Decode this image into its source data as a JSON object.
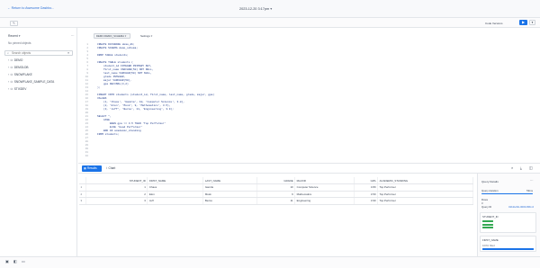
{
  "window": {
    "back_link": "Return to Awesome Dashbo...",
    "title": "2023-12-20 3:17pm"
  },
  "toolbar": {
    "code_version_label": "Code Versions",
    "run_icon": "play-icon",
    "more_icon": "chevron-down-icon"
  },
  "sidebar": {
    "recent_label": "Recent",
    "pinned_label": "No pinned objects",
    "search_placeholder": "Search objects",
    "databases": [
      "DEMO",
      "DEMOLDB",
      "SNOWFLAKE",
      "SNOWFLAKE_SAMPLE_DATA",
      "STIXDEV"
    ]
  },
  "editor": {
    "tab_label": "DEMO.DEMO_SCHEMA",
    "settings_label": "Settings",
    "line_numbers": [
      "1",
      "2",
      "3",
      "4",
      "5",
      "6",
      "7",
      "8",
      "9",
      "10",
      "11",
      "12",
      "13",
      "14",
      "15",
      "16",
      "17",
      "18",
      "19",
      "20",
      "21",
      "22",
      "23",
      "24",
      "25",
      "26",
      "27",
      "28",
      "29",
      "30",
      "31",
      "32"
    ],
    "code_lines": [
      "CREATE DATABASE demo_db;",
      "CREATE SCHEMA demo_schema;",
      "",
      "DROP TABLE students;",
      "",
      "CREATE TABLE students (",
      "    student_id INTEGER PRIMARY KEY,",
      "    first_name VARCHAR(50) NOT NULL,",
      "    last_name VARCHAR(50) NOT NULL,",
      "    grade INTEGER,",
      "    major VARCHAR(50),",
      "    gpa DECIMAL(3,2)",
      ");",
      "",
      "INSERT INTO students (student_id, first_name, last_name, grade, major, gpa)",
      "VALUES",
      "    (1, 'Chaos', 'Gamila', 10, 'Computer Science', 3.8),",
      "    (2, 'Elon', 'Musk', 9, 'Mathematics', 3.5),",
      "    (3, 'Jeff', 'Bezos', 11, 'Engineering', 3.9);",
      "",
      "SELECT *,",
      "    CASE",
      "        WHEN gpa >= 3.5 THEN 'Top Performer'",
      "        ELSE 'Good Performer'",
      "    END AS academic_standing",
      "FROM students;",
      "",
      "",
      "",
      "",
      "",
      ""
    ]
  },
  "results": {
    "tab_results": "Results",
    "tab_chart": "Chart",
    "columns": [
      "",
      "STUDENT_ID",
      "FIRST_NAME",
      "LAST_NAME",
      "GRADE",
      "MAJOR",
      "GPA",
      "ACADEMIC_STANDING"
    ],
    "rows": [
      [
        "1",
        "1",
        "Chaos",
        "Gamila",
        "10",
        "Computer Science",
        "3.80",
        "Top Performer"
      ],
      [
        "2",
        "2",
        "Elon",
        "Musk",
        "9",
        "Mathematics",
        "3.50",
        "Top Performer"
      ],
      [
        "3",
        "3",
        "Jeff",
        "Bezos",
        "11",
        "Engineering",
        "3.90",
        "Top Performer"
      ]
    ]
  },
  "query_details": {
    "title": "Query Details",
    "duration_label": "Query duration",
    "duration_value": "59ms",
    "duration_fill": 1.0,
    "rows_label": "Rows",
    "rows_value": "3",
    "query_id_label": "Query ID",
    "query_id_value": "01b11cbb-0000-80fc-0",
    "student_id_label": "STUDENT_ID",
    "first_name_label": "FIRST_NAME",
    "first_name_filled": "100% filled"
  },
  "colors": {
    "accent": "#1a73e8",
    "link": "#2b6fd6",
    "bar_green": "#34a853"
  }
}
